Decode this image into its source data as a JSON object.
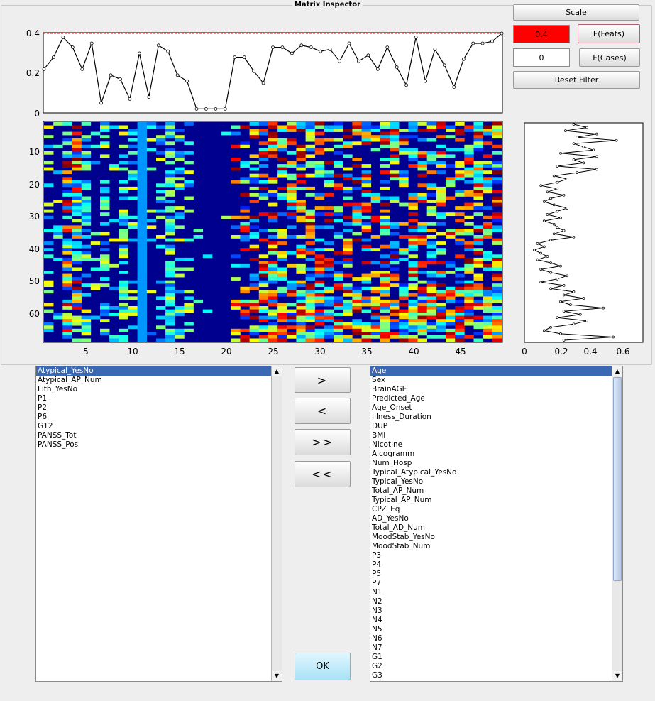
{
  "window": {
    "title": "Matrix Inspector"
  },
  "controls": {
    "scale_label": "Scale",
    "feats_threshold": "0.4",
    "feats_button": "F(Feats)",
    "cases_threshold": "0",
    "cases_button": "F(Cases)",
    "reset_button": "Reset Filter"
  },
  "top_plot": {
    "y_ticks": [
      "0.4",
      "0.2",
      "0"
    ],
    "values": [
      0.22,
      0.28,
      0.38,
      0.33,
      0.22,
      0.35,
      0.05,
      0.19,
      0.17,
      0.07,
      0.3,
      0.08,
      0.34,
      0.31,
      0.19,
      0.16,
      0.02,
      0.02,
      0.02,
      0.02,
      0.28,
      0.28,
      0.21,
      0.15,
      0.33,
      0.33,
      0.3,
      0.34,
      0.33,
      0.31,
      0.32,
      0.26,
      0.35,
      0.26,
      0.29,
      0.22,
      0.33,
      0.23,
      0.14,
      0.38,
      0.16,
      0.32,
      0.24,
      0.13,
      0.27,
      0.35,
      0.35,
      0.36,
      0.4
    ],
    "threshold": 0.4,
    "threshold_color": "#ff0000"
  },
  "heatmap": {
    "y_ticks": [
      "10",
      "20",
      "30",
      "40",
      "50",
      "60"
    ],
    "x_ticks": [
      "5",
      "10",
      "15",
      "20",
      "25",
      "30",
      "35",
      "40",
      "45"
    ],
    "rows": 68,
    "cols": 49,
    "colormap": "jet"
  },
  "side_plot": {
    "x_ticks": [
      "0",
      "0.2",
      "0.4",
      "0.6"
    ],
    "values": [
      0.3,
      0.38,
      0.25,
      0.44,
      0.32,
      0.56,
      0.3,
      0.36,
      0.42,
      0.22,
      0.44,
      0.3,
      0.36,
      0.2,
      0.44,
      0.32,
      0.18,
      0.26,
      0.2,
      0.1,
      0.2,
      0.14,
      0.24,
      0.16,
      0.12,
      0.18,
      0.26,
      0.2,
      0.14,
      0.22,
      0.12,
      0.18,
      0.2,
      0.24,
      0.18,
      0.3,
      0.16,
      0.08,
      0.12,
      0.06,
      0.1,
      0.14,
      0.08,
      0.16,
      0.22,
      0.1,
      0.16,
      0.26,
      0.2,
      0.1,
      0.24,
      0.16,
      0.3,
      0.24,
      0.36,
      0.22,
      0.28,
      0.48,
      0.24,
      0.34,
      0.2,
      0.38,
      0.3,
      0.16,
      0.12,
      0.22,
      0.54,
      0.24
    ]
  },
  "left_list": {
    "items": [
      "Atypical_YesNo",
      "Atypical_AP_Num",
      "Lith_YesNo",
      "P1",
      "P2",
      "P6",
      "G12",
      "PANSS_Tot",
      "PANSS_Pos"
    ],
    "selected_index": 0
  },
  "transfer_buttons": {
    "add": ">",
    "remove": "<",
    "add_all": ">>",
    "remove_all": "<<"
  },
  "right_list": {
    "items": [
      "Age",
      "Sex",
      "BrainAGE",
      "Predicted_Age",
      "Age_Onset",
      "Illness_Duration",
      "DUP",
      "BMI",
      "Nicotine",
      "Alcogramm",
      "Num_Hosp",
      "Typical_Atypical_YesNo",
      "Typical_YesNo",
      "Total_AP_Num",
      "Typical_AP_Num",
      "CPZ_Eq",
      "AD_YesNo",
      "Total_AD_Num",
      "MoodStab_YesNo",
      "MoodStab_Num",
      "P3",
      "P4",
      "P5",
      "P7",
      "N1",
      "N2",
      "N3",
      "N4",
      "N5",
      "N6",
      "N7",
      "G1",
      "G2",
      "G3"
    ],
    "selected_index": 0
  },
  "ok_button": "OK",
  "colors": {
    "accent_red": "#ff0000",
    "selection": "#3a68b2",
    "ok_button": "#c0ecfb"
  }
}
